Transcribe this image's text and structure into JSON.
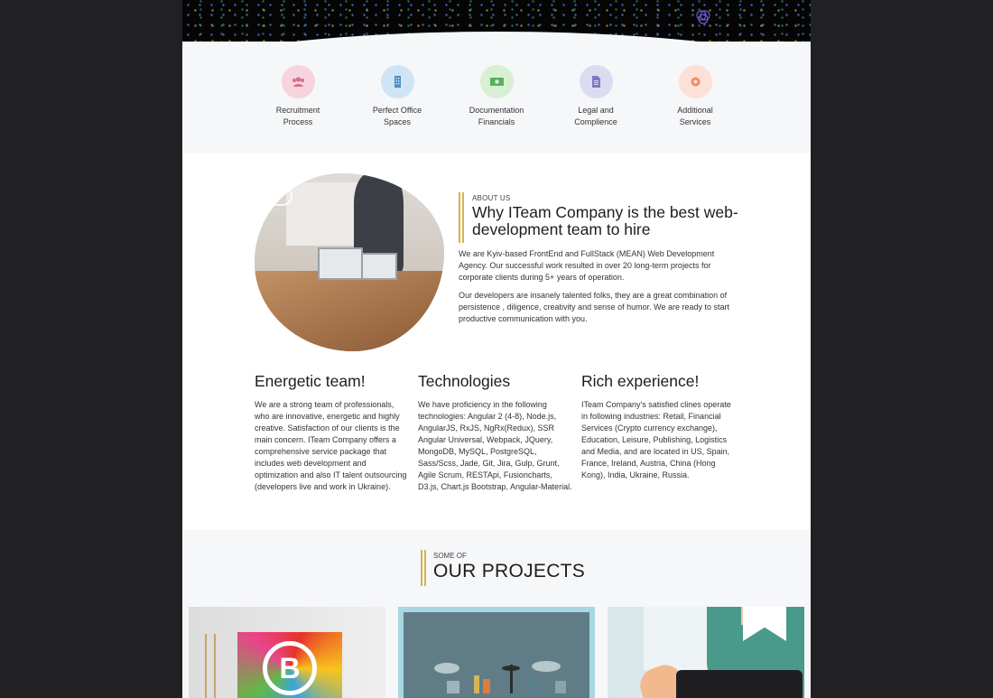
{
  "services": [
    {
      "label1": "Recruitment",
      "label2": "Process",
      "icon": "people-icon",
      "color": "#f6d3dd",
      "accent": "#d86b8a"
    },
    {
      "label1": "Perfect Office",
      "label2": "Spaces",
      "icon": "building-icon",
      "color": "#cfe4f4",
      "accent": "#4a90c8"
    },
    {
      "label1": "Documentation",
      "label2": "Financials",
      "icon": "money-icon",
      "color": "#d9efd4",
      "accent": "#58b05a"
    },
    {
      "label1": "Legal and",
      "label2": "Complience",
      "icon": "document-icon",
      "color": "#dcdcf1",
      "accent": "#7a7ac4"
    },
    {
      "label1": "Additional",
      "label2": "Services",
      "icon": "gear-icon",
      "color": "#fde0d8",
      "accent": "#ef8a6a"
    }
  ],
  "about": {
    "eyebrow": "ABOUT US",
    "title": "Why ITeam Company is the best web-development team to hire",
    "p1": "We are Kyiv-based FrontEnd and FullStack (MEAN) Web Development Agency. Our successful work resulted in over 20 long-term projects for corporate clients during 5+ years of operation.",
    "p2": "Our developers are insanely talented folks, they are a great combination of persistence , diligence, creativity and sense of humor. We are ready to start productive communication with you."
  },
  "columns": [
    {
      "title": "Energetic team!",
      "text": "We are a strong team of professionals, who are innovative, energetic and highly creative. Satisfaction of our clients is the main concern. ITeam Company offers a comprehensive service package that includes web development and optimization and also IT talent outsourcing (developers live and work in Ukraine)."
    },
    {
      "title": "Technologies",
      "text": "We have proficiency in the following technologies: Angular 2 (4-8), Node.js, AngularJS, RxJS, NgRx(Redux), SSR Angular Universal, Webpack, JQuery, MongoDB, MySQL, PostgreSQL, Sass/Scss, Jade, Git, Jira, Gulp, Grunt, Agile Scrum, RESTApi, Fusioncharts, D3.js, Chart.js Bootstrap, Angular-Material."
    },
    {
      "title": "Rich experience!",
      "text": "ITeam Company's satisfied clines operate in following industries: Retail, Financial Services (Crypto currency exchange), Education, Leisure, Publishing, Logistics and Media, and are located in US, Spain, France, Ireland, Austria, China (Hong Kong), India, Ukraine, Russia."
    }
  ],
  "projects": {
    "eyebrow": "SOME OF",
    "title": "OUR PROJECTS",
    "coin_symbol": "B"
  },
  "colors": {
    "accent_gold": "#d4b451",
    "background_dark": "#212124",
    "section_light": "#f6f7f9"
  }
}
